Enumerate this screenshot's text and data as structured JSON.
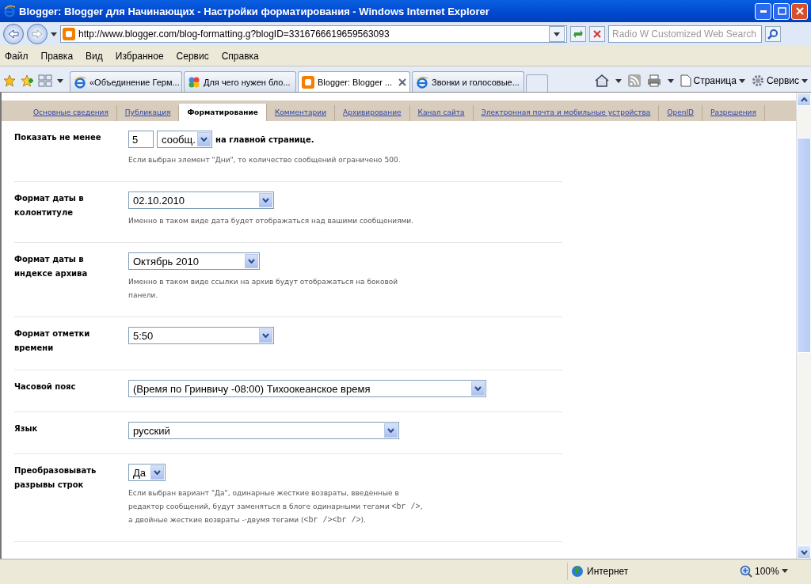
{
  "window": {
    "title": "Blogger: Blogger для Начинающих - Настройки форматирования - Windows Internet Explorer"
  },
  "address": {
    "url": "http://www.blogger.com/blog-formatting.g?blogID=3316766619659563093",
    "search_placeholder": "Radio W Customized Web Search"
  },
  "menu": [
    "Файл",
    "Правка",
    "Вид",
    "Избранное",
    "Сервис",
    "Справка"
  ],
  "browser_tabs": [
    {
      "label": "«Объединение Герм...",
      "kind": "ie",
      "selected": false
    },
    {
      "label": "Для чего нужен бло...",
      "kind": "google",
      "selected": false
    },
    {
      "label": "Blogger: Blogger ...",
      "kind": "blogger",
      "selected": true
    },
    {
      "label": "Звонки и голосовые...",
      "kind": "ie",
      "selected": false
    }
  ],
  "command_bar": {
    "page": "Страница",
    "tools": "Сервис"
  },
  "settings_tabs": [
    {
      "label": "Основные сведения",
      "selected": false
    },
    {
      "label": "Публикация",
      "selected": false
    },
    {
      "label": "Форматирование",
      "selected": true
    },
    {
      "label": "Комментарии",
      "selected": false
    },
    {
      "label": "Архивирование",
      "selected": false
    },
    {
      "label": "Канал сайта",
      "selected": false
    },
    {
      "label": "Электронная почта и мобильные устройства",
      "selected": false
    },
    {
      "label": "OpenID",
      "selected": false
    },
    {
      "label": "Разрешения",
      "selected": false
    }
  ],
  "settings": [
    {
      "label": "Показать не менее",
      "controls": [
        {
          "kind": "input",
          "value": "5"
        },
        {
          "kind": "select",
          "value": "сообщ."
        },
        {
          "kind": "text",
          "value": "на главной странице."
        }
      ],
      "note": [
        {
          "kind": "text",
          "text": "Если выбран элемент \"Дни\", то количество сообщений ограничено 500."
        }
      ]
    },
    {
      "label": "Формат даты в колонтитуле",
      "controls": [
        {
          "kind": "select",
          "value": "02.10.2010"
        }
      ],
      "note": [
        {
          "kind": "text",
          "text": "Именно в таком виде дата будет отображаться над вашими сообщениями."
        }
      ]
    },
    {
      "label": "Формат даты в индексе архива",
      "controls": [
        {
          "kind": "select",
          "value": "Октябрь 2010"
        }
      ],
      "note": [
        {
          "kind": "text",
          "text": "Именно в таком виде ссылки на архив будут отображаться на боковой панели."
        }
      ]
    },
    {
      "label": "Формат отметки времени",
      "controls": [
        {
          "kind": "select",
          "value": "5:50"
        }
      ]
    },
    {
      "label": "Часовой пояс",
      "controls": [
        {
          "kind": "select",
          "value": "(Время по Гринвичу -08:00) Тихоокеанское время"
        }
      ]
    },
    {
      "label": "Язык",
      "controls": [
        {
          "kind": "select",
          "value": "русский"
        }
      ]
    },
    {
      "label": "Преобразовывать разрывы строк",
      "controls": [
        {
          "kind": "select",
          "value": "Да"
        }
      ],
      "note": [
        {
          "kind": "text",
          "text": "Если выбран вариант \"Да\", одинарные жесткие возвраты, введенные в редактор сообщений, будут заменяться в блоге одинарными тегами "
        },
        {
          "kind": "code",
          "text": "<br />"
        },
        {
          "kind": "text",
          "text": ", а двойные жесткие возвраты -·двумя тегами ("
        },
        {
          "kind": "code",
          "text": "<br /><br />"
        },
        {
          "kind": "text",
          "text": ")."
        }
      ]
    }
  ],
  "status_bar": {
    "zone": "Интернет",
    "zoom": "100%"
  }
}
